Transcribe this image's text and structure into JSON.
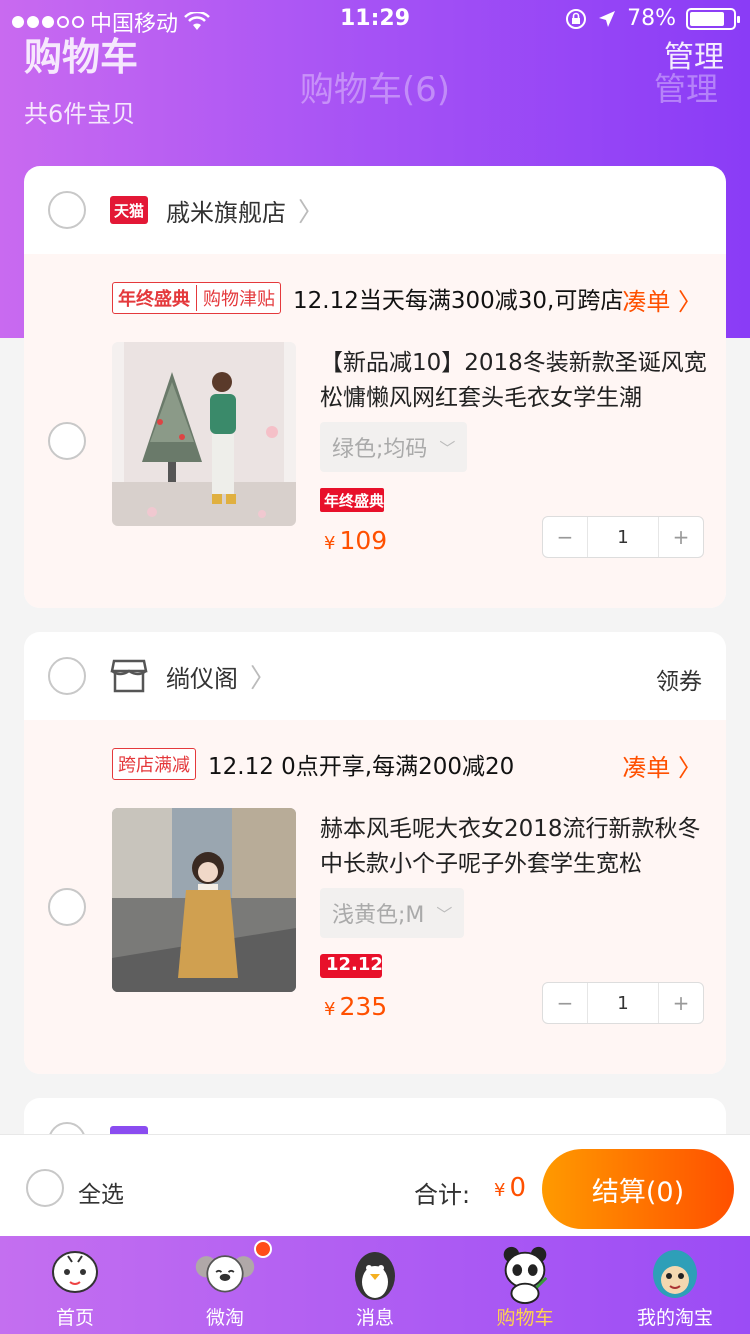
{
  "status_bar": {
    "carrier": "中国移动",
    "time": "11:29",
    "battery": "78%"
  },
  "header": {
    "title": "购物车",
    "center_title": "购物车(6)",
    "manage": "管理",
    "manage_fade": "管理",
    "subtitle": "共6件宝贝"
  },
  "stores": [
    {
      "logo_text": "天猫",
      "name": "戚米旗舰店",
      "promo_tag_a": "年终盛典",
      "promo_tag_b": "购物津贴",
      "promo_text": "12.12当天每满300减30,可跨店",
      "add_on": "凑单",
      "item": {
        "title": "【新品减10】2018冬装新款圣诞风宽松慵懒风网红套头毛衣女学生潮",
        "sku": "绿色;均码",
        "badge": "年终盛典",
        "currency": "¥",
        "price": "109",
        "qty": "1"
      }
    },
    {
      "name": "绱仪阁",
      "coupon": "领券",
      "promo_tag": "跨店满减",
      "promo_text": "12.12 0点开享,每满200减20",
      "add_on": "凑单",
      "item": {
        "title": "赫本风毛呢大衣女2018流行新款秋冬中长款小个子呢子外套学生宽松",
        "sku": "浅黄色;M",
        "badge": "12.12",
        "currency": "¥",
        "price": "235",
        "qty": "1"
      }
    }
  ],
  "checkout": {
    "select_all": "全选",
    "total_label": "合计:",
    "currency": "¥",
    "total": "0",
    "settle": "结算(0)"
  },
  "tabs": [
    {
      "label": "首页",
      "icon": "tiger-mascot-icon"
    },
    {
      "label": "微淘",
      "icon": "koala-mascot-icon"
    },
    {
      "label": "消息",
      "icon": "penguin-mascot-icon"
    },
    {
      "label": "购物车",
      "icon": "panda-mascot-icon",
      "active": true
    },
    {
      "label": "我的淘宝",
      "icon": "fish-mascot-icon"
    }
  ],
  "colors": {
    "accent": "#ff5000",
    "brand_purple": "#a552f5",
    "active_tab": "#ffd24d"
  }
}
